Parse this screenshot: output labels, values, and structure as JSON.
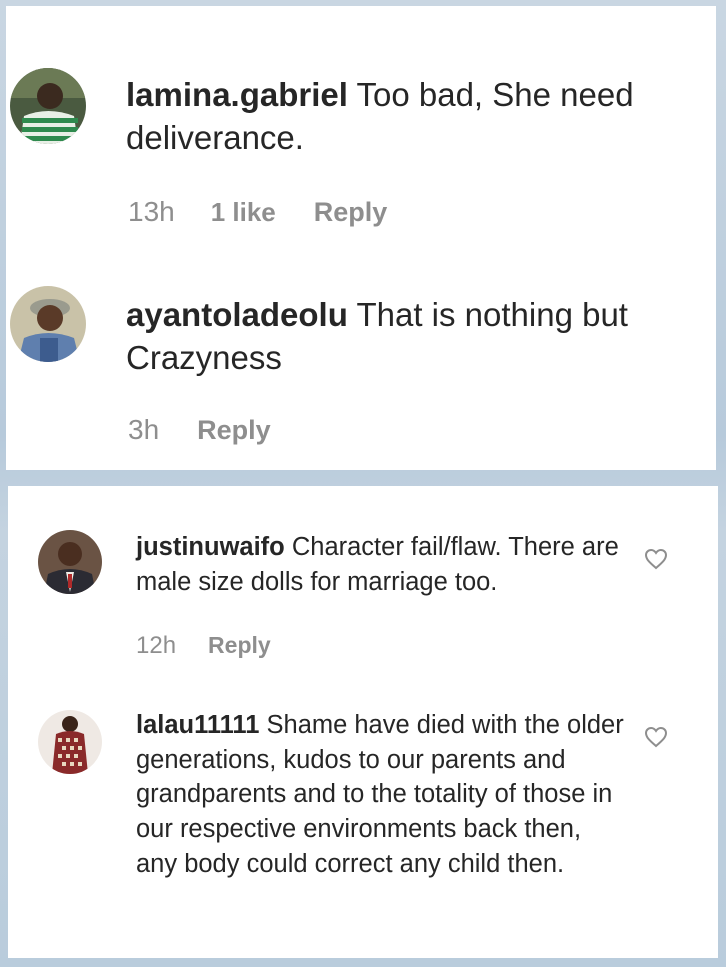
{
  "comments_top": [
    {
      "username": "lamina.gabriel",
      "text": "Too bad, She need deliverance.",
      "time": "13h",
      "likes": "1 like",
      "reply": "Reply",
      "avatar_icon": "avatar-photo-striped-shirt"
    },
    {
      "username": "ayantoladeolu",
      "text": "That is nothing but Crazyness",
      "time": "3h",
      "reply": "Reply",
      "avatar_icon": "avatar-photo-cap"
    }
  ],
  "comments_bottom": [
    {
      "username": "justinuwaifo",
      "text": "Character fail/flaw. There are male size dolls for marriage too.",
      "time": "12h",
      "reply": "Reply",
      "avatar_icon": "avatar-photo-suit"
    },
    {
      "username": "lalau11111",
      "text": "Shame have died with the older generations, kudos to our parents and grandparents and to the totality of those in our respective environments back then, any body could correct any child then.",
      "time": "",
      "reply": "",
      "avatar_icon": "avatar-photo-patterned-dress"
    }
  ],
  "colors": {
    "text": "#262626",
    "meta": "#8e8e8e",
    "background": "#c4d3e0"
  }
}
